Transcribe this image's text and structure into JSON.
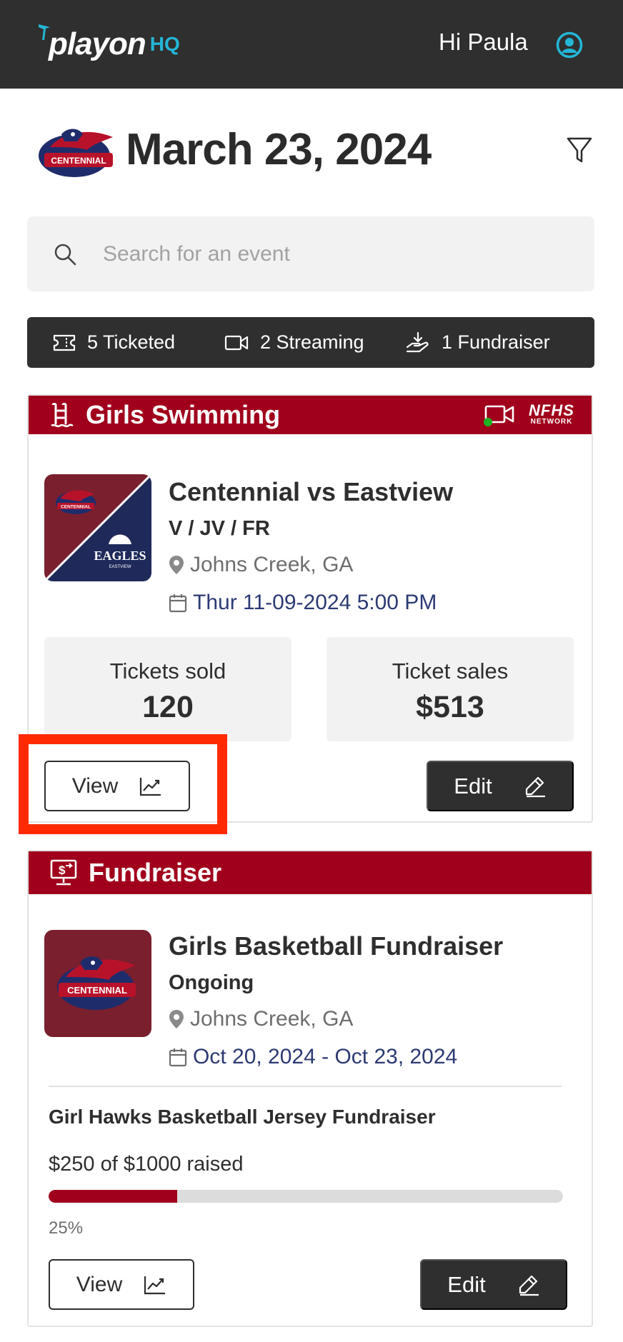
{
  "header": {
    "logo_text": "playon",
    "logo_suffix": "HQ",
    "greeting": "Hi Paula"
  },
  "date_title": "March 23, 2024",
  "search": {
    "placeholder": "Search for an event",
    "value": ""
  },
  "summary": {
    "ticketed": "5 Ticketed",
    "streaming": "2 Streaming",
    "fundraiser": "1 Fundraiser"
  },
  "event_card": {
    "category": "Girls Swimming",
    "network_logo_line1": "NFHS",
    "network_logo_line2": "NETWORK",
    "thumb_home_text": "CENTENNIAL",
    "thumb_away_text": "EAGLES",
    "thumb_away_subtext": "EASTVIEW",
    "title": "Centennial vs Eastview",
    "levels": "V / JV / FR",
    "location": "Johns Creek, GA",
    "datetime": "Thur 11-09-2024 5:00 PM",
    "stats": [
      {
        "label": "Tickets sold",
        "value": "120"
      },
      {
        "label": "Ticket sales",
        "value": "$513"
      }
    ],
    "view_label": "View",
    "edit_label": "Edit",
    "live_indicator_color": "#1db524"
  },
  "fundraiser_card": {
    "category": "Fundraiser",
    "thumb_text": "CENTENNIAL",
    "title": "Girls Basketball Fundraiser",
    "status": "Ongoing",
    "location": "Johns Creek, GA",
    "date_range": "Oct 20, 2024 - Oct 23, 2024",
    "campaign_name": "Girl Hawks Basketball Jersey Fundraiser",
    "raised_text": "$250 of $1000 raised",
    "progress_fraction": 0.25,
    "percent_label": "25%",
    "view_label": "View",
    "edit_label": "Edit"
  },
  "colors": {
    "brand_red": "#a0001b",
    "header_dark": "#2f2f2f",
    "accent_cyan": "#24b6d6",
    "date_blue": "#2c3a74",
    "highlight": "#ff2a00"
  }
}
